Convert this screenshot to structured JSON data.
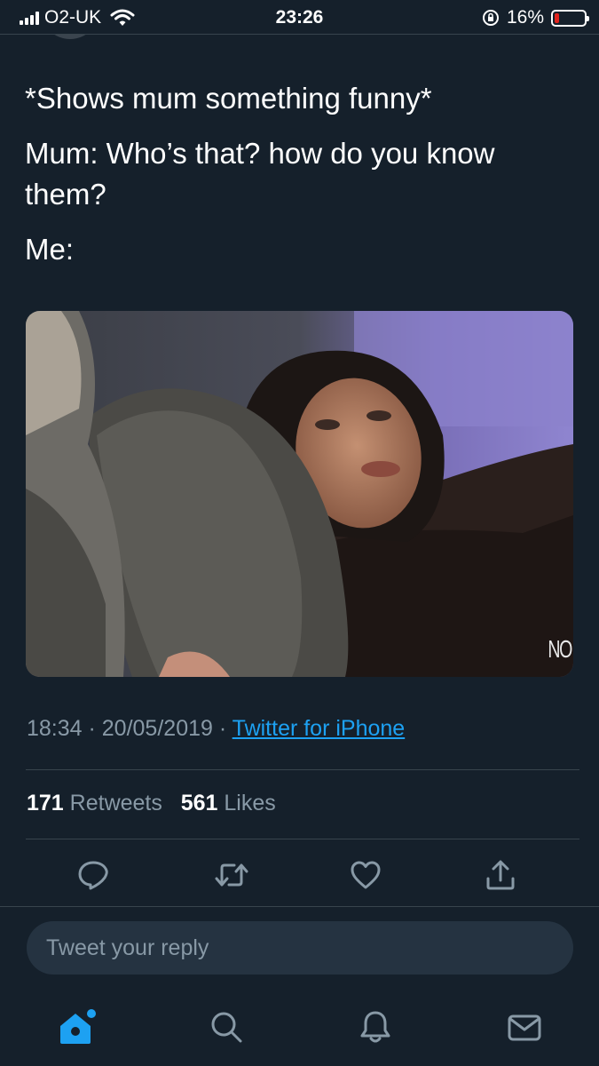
{
  "status_bar": {
    "carrier": "O2-UK",
    "time": "23:26",
    "battery_percent": "16%",
    "battery_level": 0.16,
    "battery_color": "#e0241d"
  },
  "tweet": {
    "lines": [
      "*Shows mum something funny*",
      "Mum: Who’s that? how do you know them?",
      "Me:"
    ],
    "media_overlay_text": "NO",
    "timestamp": "18:34 · 20/05/2019 · ",
    "source": "Twitter for iPhone",
    "retweets_count": "171",
    "retweets_label": " Retweets",
    "likes_count": "561",
    "likes_label": " Likes"
  },
  "actions": {
    "icons": [
      "reply-icon",
      "retweet-icon",
      "like-icon",
      "share-icon"
    ]
  },
  "reply": {
    "placeholder": "Tweet your reply"
  },
  "tabbar": {
    "icons": [
      "home-icon",
      "search-icon",
      "notifications-icon",
      "messages-icon"
    ],
    "active": "home-icon"
  },
  "colors": {
    "background": "#15202b",
    "accent": "#1da1f2",
    "muted": "#8899a6",
    "divider": "#38444d"
  }
}
